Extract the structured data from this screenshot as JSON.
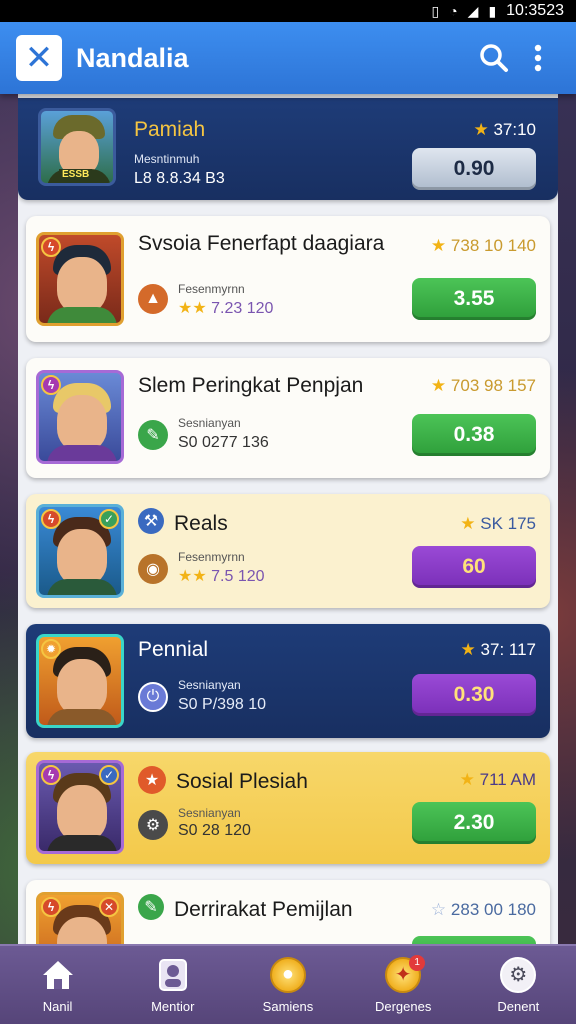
{
  "status_bar": {
    "time": "10:3523"
  },
  "app": {
    "title": "Nandalia",
    "logo_icon": "close-x-icon"
  },
  "cards": [
    {
      "title": "Pamiah",
      "sub_label": "Mesntinmuh",
      "sub_value": "L8 8.8.34 B3",
      "rating": "37:10",
      "button": "0.90",
      "avatar_text": "ESSB"
    },
    {
      "title": "Svsoia Fenerfapt daagiara",
      "sub_label": "Fesenmyrnn",
      "sub_value": "7.23 120",
      "stars": "★★",
      "rating": "738 10 140",
      "button": "3.55"
    },
    {
      "title": "Slem Peringkat Penpjan",
      "sub_label": "Sesnianyan",
      "sub_value": "S0 0277 136",
      "rating": "703 98 157",
      "button": "0.38"
    },
    {
      "title": "Reals",
      "sub_label": "Fesenmyrnn",
      "sub_value": "7.5 120",
      "stars": "★★",
      "rating": "SK 175",
      "button": "60"
    },
    {
      "title": "Pennial",
      "sub_label": "Sesnianyan",
      "sub_value": "S0 P/398 10",
      "rating": "37: 117",
      "button": "0.30"
    },
    {
      "title": "Sosial Plesiah",
      "sub_label": "Sesnianyan",
      "sub_value": "S0 28 120",
      "rating": "711 AM",
      "button": "2.30"
    },
    {
      "title": "Derrirakat Pemijlan",
      "rating": "283 00 180"
    }
  ],
  "bottom_nav": [
    {
      "label": "Nanil",
      "icon": "home-icon"
    },
    {
      "label": "Mentior",
      "icon": "profile-card-icon"
    },
    {
      "label": "Samiens",
      "icon": "coin-icon"
    },
    {
      "label": "Dergenes",
      "icon": "gift-icon",
      "badge": "1"
    },
    {
      "label": "Denent",
      "icon": "settings-icon"
    }
  ],
  "colors": {
    "app_bar": "#2d74d6",
    "green_button": "#2e9e3a",
    "purple_button": "#7a2fb8",
    "navy_card": "#1e3c78",
    "bottom_nav": "#6c5a94"
  }
}
